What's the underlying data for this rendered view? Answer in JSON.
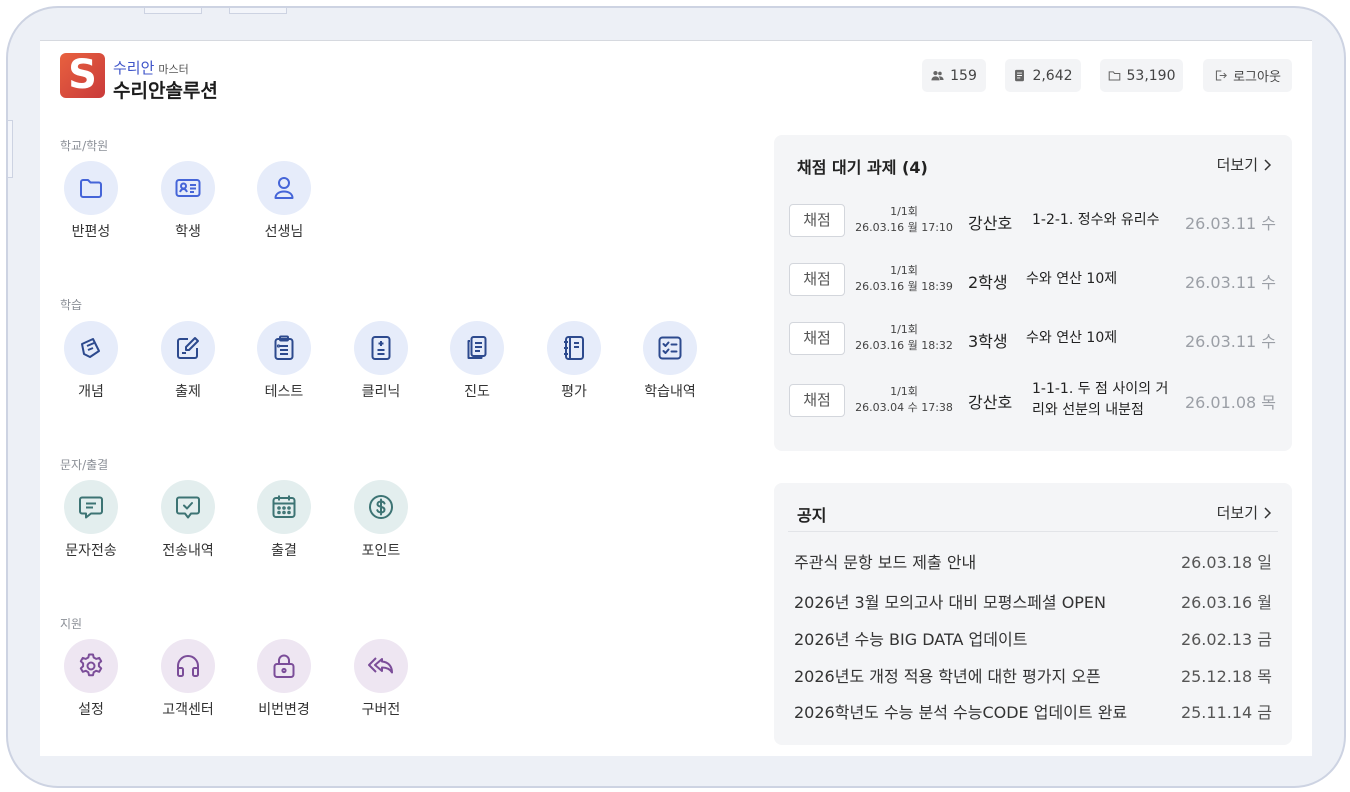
{
  "brand": {
    "logo_letter": "S",
    "service": "수리안",
    "role": "마스터",
    "name": "수리안솔루션",
    "logo_color": "#d9473c"
  },
  "header": {
    "stats": [
      {
        "icon": "users-icon",
        "value": "159"
      },
      {
        "icon": "document-icon",
        "value": "2,642"
      },
      {
        "icon": "folder-icon",
        "value": "53,190"
      }
    ],
    "logout_label": "로그아웃"
  },
  "menu": {
    "sections": [
      {
        "title": "학교/학원",
        "items": [
          {
            "label": "반편성",
            "icon": "folder-icon"
          },
          {
            "label": "학생",
            "icon": "id-card-icon"
          },
          {
            "label": "선생님",
            "icon": "person-icon"
          }
        ]
      },
      {
        "title": "학습",
        "items": [
          {
            "label": "개념",
            "icon": "concept-icon"
          },
          {
            "label": "출제",
            "icon": "edit-icon"
          },
          {
            "label": "테스트",
            "icon": "clipboard-icon"
          },
          {
            "label": "클리닉",
            "icon": "calculator-icon"
          },
          {
            "label": "진도",
            "icon": "pages-icon"
          },
          {
            "label": "평가",
            "icon": "notebook-icon"
          },
          {
            "label": "학습내역",
            "icon": "checklist-icon"
          }
        ]
      },
      {
        "title": "문자/출결",
        "items": [
          {
            "label": "문자전송",
            "icon": "message-icon"
          },
          {
            "label": "전송내역",
            "icon": "message-check-icon"
          },
          {
            "label": "출결",
            "icon": "calendar-icon"
          },
          {
            "label": "포인트",
            "icon": "dollar-icon"
          }
        ]
      },
      {
        "title": "지원",
        "items": [
          {
            "label": "설정",
            "icon": "gear-icon"
          },
          {
            "label": "고객센터",
            "icon": "headphones-icon"
          },
          {
            "label": "비번변경",
            "icon": "lock-icon"
          },
          {
            "label": "구버전",
            "icon": "reply-all-icon"
          }
        ]
      }
    ]
  },
  "grading": {
    "title": "채점 대기 과제 (4)",
    "more_label": "더보기",
    "rows": [
      {
        "button": "채점",
        "round": "1/1회",
        "submitted": "26.03.16 월 17:10",
        "student": "강산호",
        "assignment": "1-2-1.  정수와 유리수",
        "due": "26.03.11 수"
      },
      {
        "button": "채점",
        "round": "1/1회",
        "submitted": "26.03.16 월 18:39",
        "student": "2학생",
        "assignment": "수와 연산 10제",
        "due": "26.03.11 수"
      },
      {
        "button": "채점",
        "round": "1/1회",
        "submitted": "26.03.16 월 18:32",
        "student": "3학생",
        "assignment": "수와 연산 10제",
        "due": "26.03.11 수"
      },
      {
        "button": "채점",
        "round": "1/1회",
        "submitted": "26.03.04 수 17:38",
        "student": "강산호",
        "assignment": "1-1-1.  두 점 사이의 거리와 선분의 내분점",
        "due": "26.01.08 목"
      }
    ]
  },
  "notice": {
    "title": "공지",
    "more_label": "더보기",
    "rows": [
      {
        "title": "주관식 문항 보드 제출 안내",
        "date": "26.03.18 일"
      },
      {
        "title": "2026년 3월 모의고사 대비 모평스페셜 OPEN",
        "date": "26.03.16 월"
      },
      {
        "title": "2026년 수능 BIG DATA 업데이트",
        "date": "26.02.13 금"
      },
      {
        "title": "2026년도 개정 적용 학년에 대한 평가지 오픈",
        "date": "25.12.18 목"
      },
      {
        "title": "2026학년도 수능 분석 수능CODE 업데이트 완료",
        "date": "25.11.14 금"
      }
    ]
  }
}
